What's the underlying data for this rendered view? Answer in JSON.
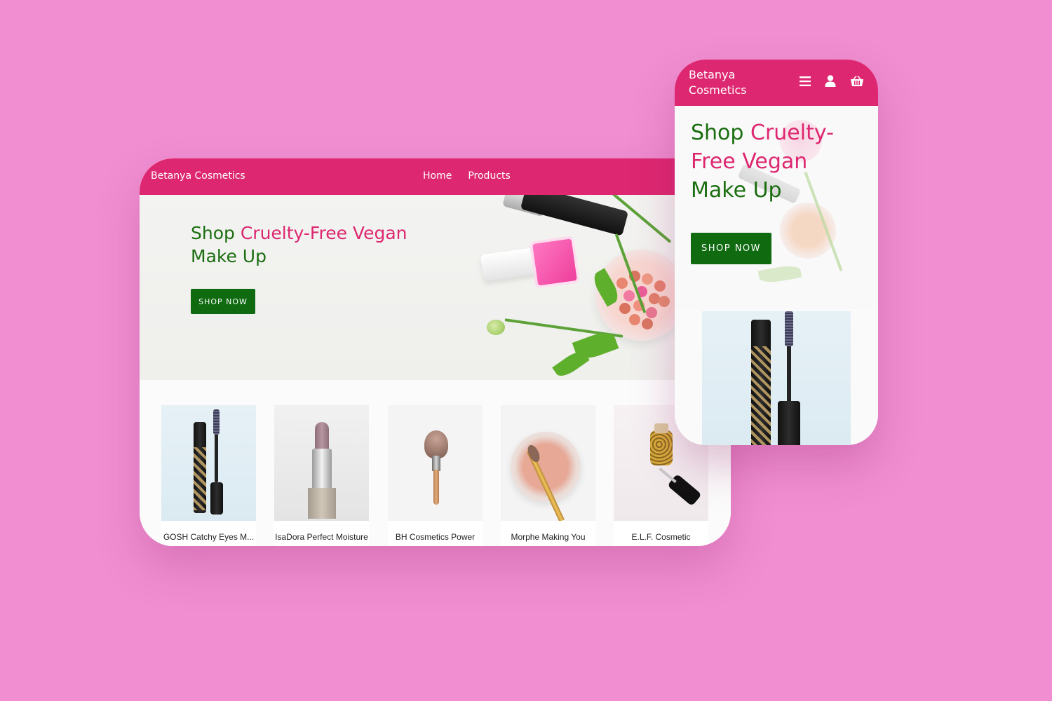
{
  "desktop": {
    "brand": "Betanya Cosmetics",
    "nav": [
      {
        "label": "Home"
      },
      {
        "label": "Products"
      }
    ],
    "hero": {
      "title_part1": "Shop",
      "title_part2": "Cruelty-Free Vegan",
      "title_part3": "Make Up",
      "cta": "SHOP NOW"
    },
    "products": [
      {
        "name": "GOSH Catchy Eyes M..."
      },
      {
        "name": "IsaDora Perfect Moisture Lipstick"
      },
      {
        "name": "BH Cosmetics Power Cheek Brush"
      },
      {
        "name": "Morphe Making You Blush Brush"
      },
      {
        "name": "E.L.F. Cosmetic Hydrating..."
      }
    ]
  },
  "mobile": {
    "brand": "Betanya Cosmetics",
    "icons": [
      "menu-icon",
      "user-icon",
      "basket-icon"
    ],
    "hero": {
      "title_part1": "Shop",
      "title_part2": "Cruelty-Free Vegan",
      "title_part3": "Make Up",
      "cta": "SHOP NOW"
    }
  },
  "colors": {
    "background": "#f08ed1",
    "brand_pink": "#dd2770",
    "brand_green": "#0f6a10",
    "title_green": "#1a6e10"
  }
}
